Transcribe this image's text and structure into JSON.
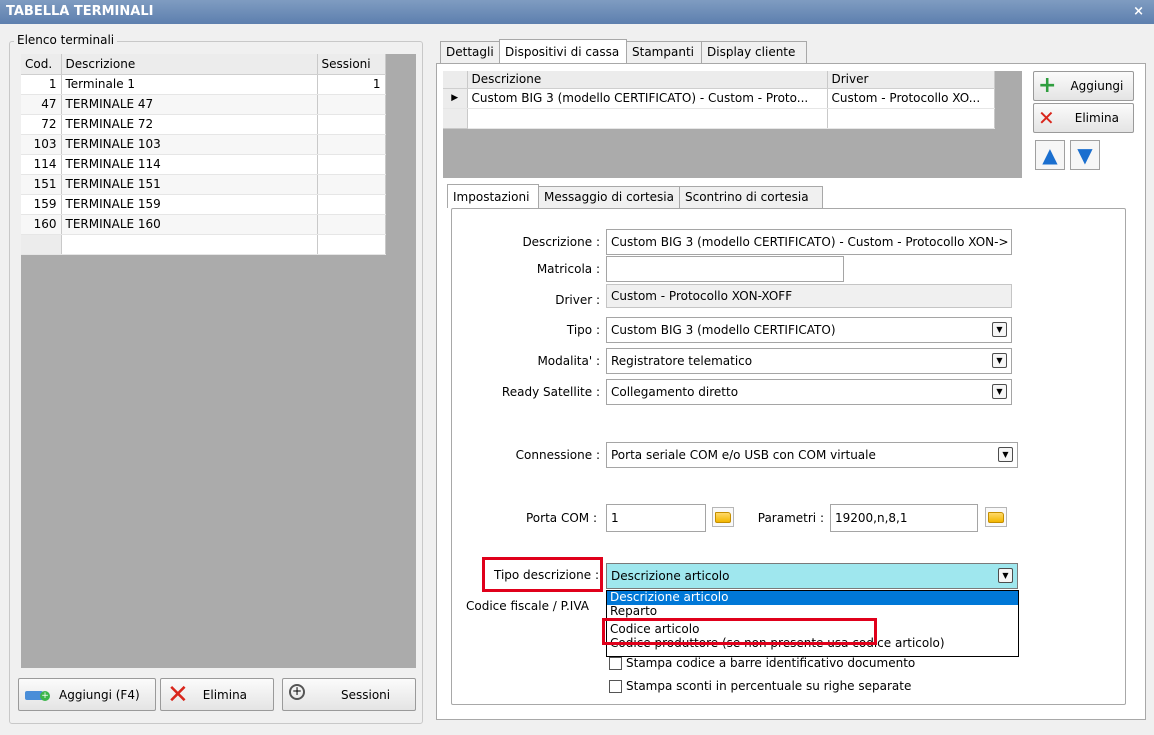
{
  "window": {
    "title": "TABELLA TERMINALI",
    "close_glyph": "×"
  },
  "terminals": {
    "group_label": "Elenco terminali",
    "columns": [
      "Cod.",
      "Descrizione",
      "Sessioni"
    ],
    "rows": [
      {
        "cod": "1",
        "desc": "Terminale 1",
        "sess": "1"
      },
      {
        "cod": "47",
        "desc": "TERMINALE 47",
        "sess": ""
      },
      {
        "cod": "72",
        "desc": "TERMINALE 72",
        "sess": ""
      },
      {
        "cod": "103",
        "desc": "TERMINALE 103",
        "sess": ""
      },
      {
        "cod": "114",
        "desc": "TERMINALE 114",
        "sess": ""
      },
      {
        "cod": "151",
        "desc": "TERMINALE 151",
        "sess": ""
      },
      {
        "cod": "159",
        "desc": "TERMINALE 159",
        "sess": ""
      },
      {
        "cod": "160",
        "desc": "TERMINALE 160",
        "sess": ""
      }
    ],
    "buttons": {
      "add": "Aggiungi (F4)",
      "delete": "Elimina",
      "sessions": "Sessioni"
    }
  },
  "tabs": [
    "Dettagli",
    "Dispositivi di cassa",
    "Stampanti",
    "Display cliente"
  ],
  "devices": {
    "columns": [
      "Descrizione",
      "Driver"
    ],
    "rows": [
      {
        "desc": "Custom BIG 3 (modello CERTIFICATO) - Custom - Proto...",
        "driver": "Custom - Protocollo XO..."
      }
    ],
    "buttons": {
      "add": "Aggiungi",
      "delete": "Elimina"
    }
  },
  "subtabs": [
    "Impostazioni",
    "Messaggio di cortesia",
    "Scontrino di cortesia"
  ],
  "form": {
    "descrizione": {
      "label": "Descrizione :",
      "value": "Custom BIG 3 (modello CERTIFICATO) - Custom - Protocollo XON->"
    },
    "matricola": {
      "label": "Matricola :",
      "value": ""
    },
    "driver": {
      "label": "Driver :",
      "value": "Custom - Protocollo XON-XOFF"
    },
    "tipo": {
      "label": "Tipo :",
      "value": "Custom BIG 3 (modello CERTIFICATO)"
    },
    "modalita": {
      "label": "Modalita' :",
      "value": "Registratore telematico"
    },
    "ready": {
      "label": "Ready Satellite :",
      "value": "Collegamento diretto"
    },
    "connessione": {
      "label": "Connessione :",
      "value": "Porta seriale COM e/o USB con COM virtuale"
    },
    "porta": {
      "label": "Porta COM :",
      "value": "1"
    },
    "parametri": {
      "label": "Parametri :",
      "value": "19200,n,8,1"
    },
    "tipo_descrizione": {
      "label": "Tipo descrizione :",
      "value": "Descrizione articolo",
      "options": [
        "Descrizione articolo",
        "Reparto",
        "Codice articolo",
        "Codice produttore (se non presente usa codice articolo)"
      ]
    },
    "codice_fiscale": {
      "label": "Codice fiscale / P.IVA"
    },
    "check_barcode": "Stampa codice a barre identificativo documento",
    "check_sconti": "Stampa sconti in percentuale su righe separate"
  },
  "colors": {
    "title_bar": "#5d7fae",
    "highlight": "#0078d7",
    "combo_active": "#9fe7ee",
    "callout": "#e0001b"
  }
}
